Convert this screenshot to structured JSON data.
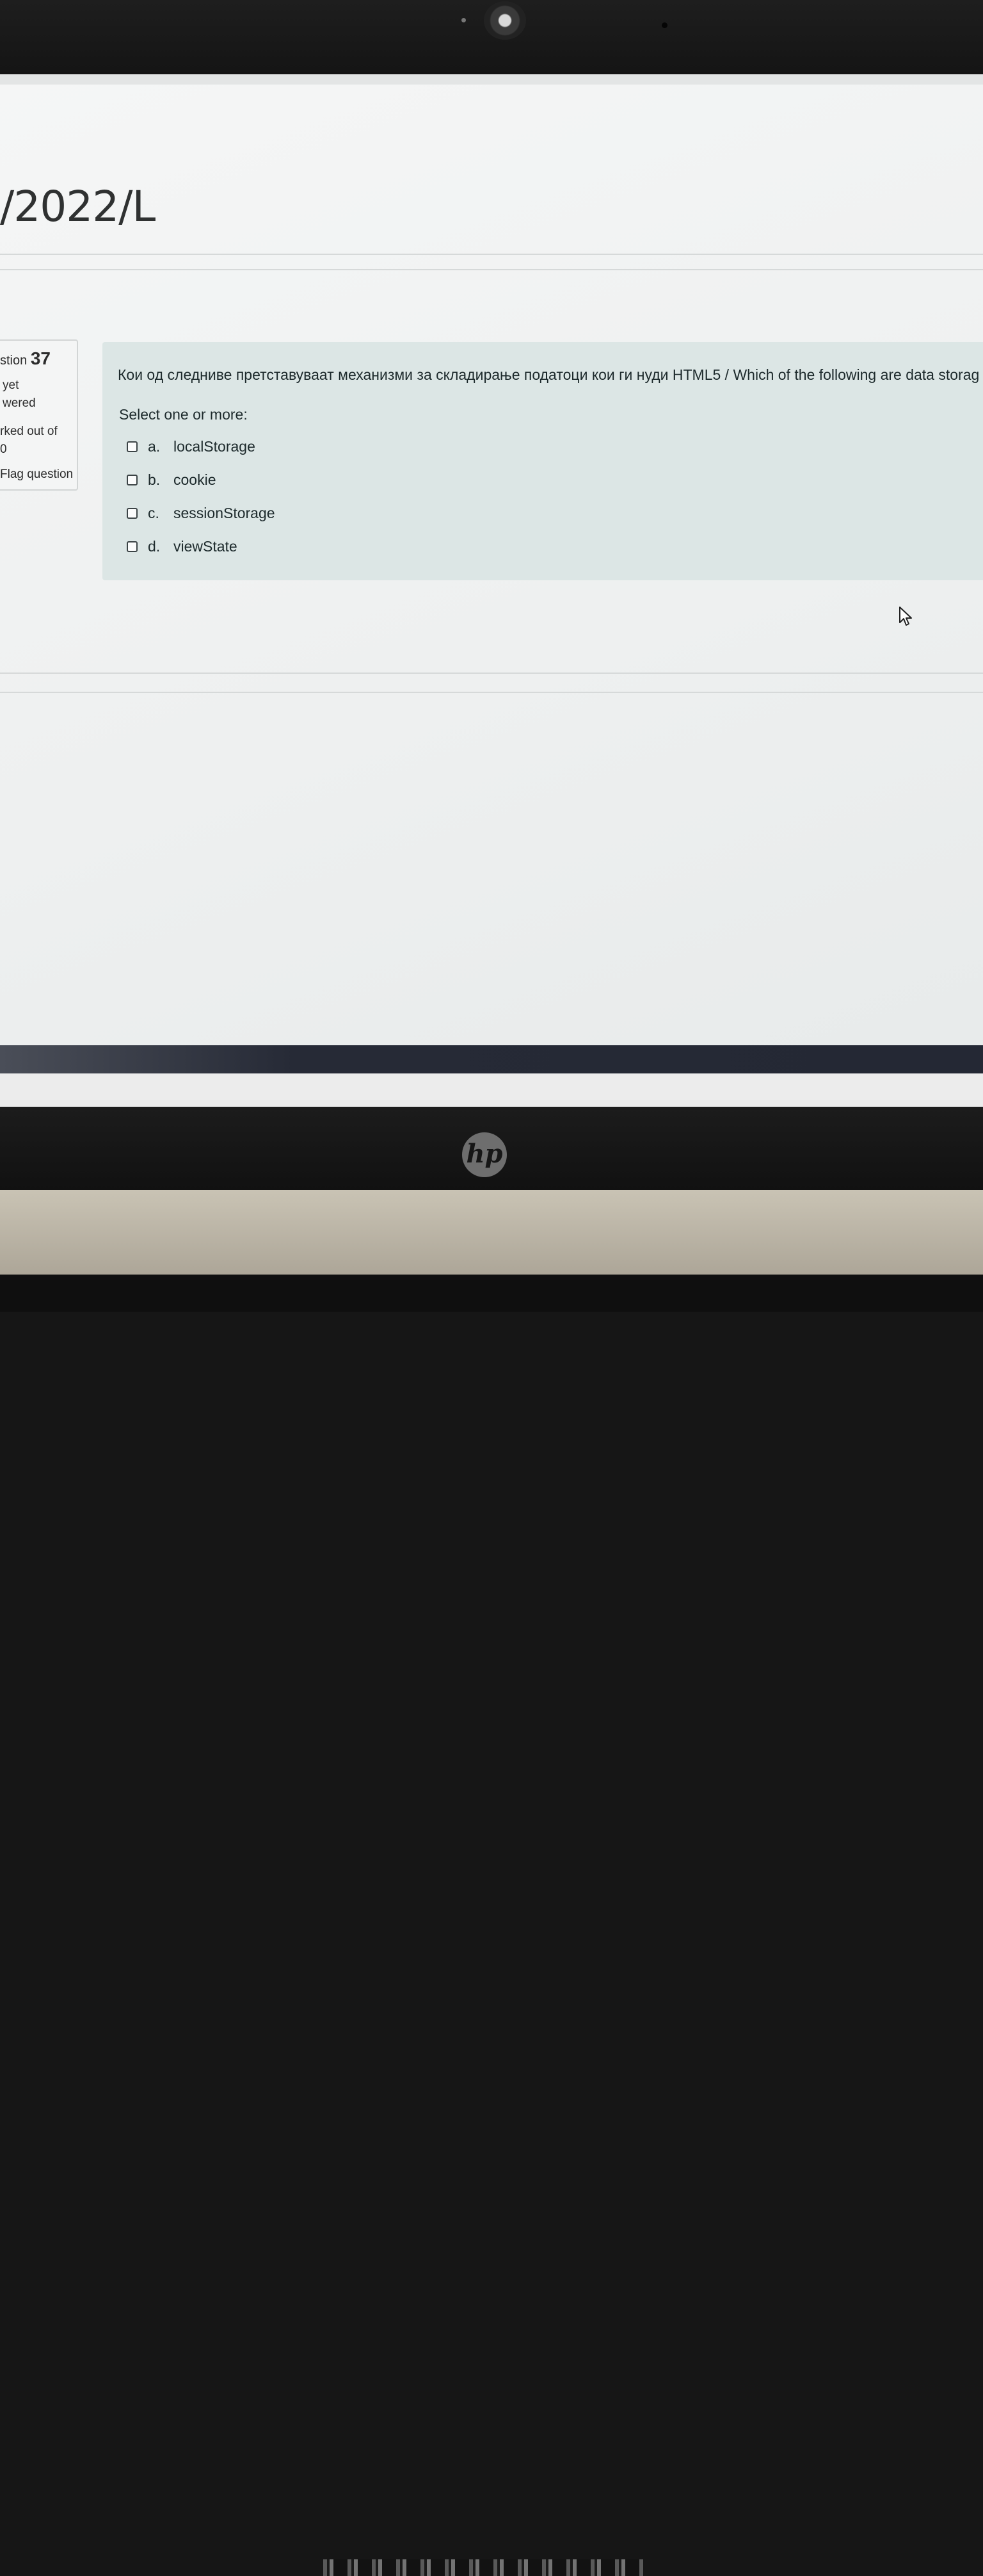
{
  "course": {
    "title_fragment": "/2022/L"
  },
  "question_info": {
    "number_prefix": "stion",
    "number": "37",
    "state": "yet\nwered",
    "grade": "rked out of\n0",
    "flag_label": "Flag question"
  },
  "question": {
    "text": "Кои од следниве претставуваат механизми за складирање податоци кои ги нуди HTML5  / Which of the following are data storag",
    "prompt": "Select one or more:",
    "options": [
      {
        "letter": "a.",
        "label": "localStorage"
      },
      {
        "letter": "b.",
        "label": "cookie"
      },
      {
        "letter": "c.",
        "label": "sessionStorage"
      },
      {
        "letter": "d.",
        "label": "viewState"
      }
    ]
  },
  "hardware": {
    "logo": "hp"
  },
  "icons": {
    "cursor": "mouse-pointer-icon",
    "checkbox": "checkbox-unchecked-icon"
  },
  "colors": {
    "question_bg": "#dce6e5",
    "info_bg": "#f4f5f5",
    "taskbar": "#262a36"
  }
}
